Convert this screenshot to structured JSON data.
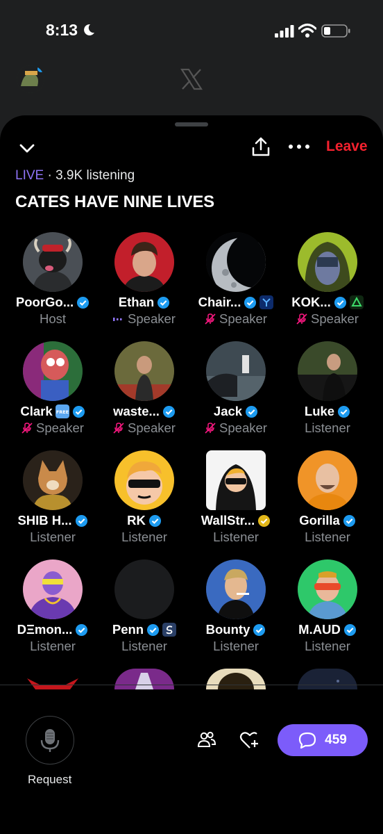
{
  "status_bar": {
    "time": "8:13"
  },
  "space": {
    "leave_label": "Leave",
    "live_label": "LIVE",
    "listening": "· 3.9K listening",
    "title": "CATES HAVE NINE LIVES"
  },
  "participants": [
    {
      "name": "PoorGo...",
      "role": "Host"
    },
    {
      "name": "Ethan",
      "role": "Speaker"
    },
    {
      "name": "Chair...",
      "role": "Speaker"
    },
    {
      "name": "KOK...",
      "role": "Speaker"
    },
    {
      "name": "Clark",
      "role": "Speaker"
    },
    {
      "name": "waste...",
      "role": "Speaker"
    },
    {
      "name": "Jack",
      "role": "Speaker"
    },
    {
      "name": "Luke",
      "role": "Listener"
    },
    {
      "name": "SHIB H...",
      "role": "Listener"
    },
    {
      "name": "RK",
      "role": "Listener"
    },
    {
      "name": "WallStr...",
      "role": "Listener"
    },
    {
      "name": "Gorilla",
      "role": "Listener"
    },
    {
      "name": "DΞmon...",
      "role": "Listener"
    },
    {
      "name": "Penn",
      "role": "Listener"
    },
    {
      "name": "Bounty",
      "role": "Listener"
    },
    {
      "name": "M.AUD",
      "role": "Listener"
    }
  ],
  "footer": {
    "request_label": "Request",
    "chat_count": "459"
  },
  "colors": {
    "live": "#8e73f6",
    "leave": "#f4212e",
    "verified": "#1d9bf0",
    "chat_button": "#7c5cfa"
  }
}
